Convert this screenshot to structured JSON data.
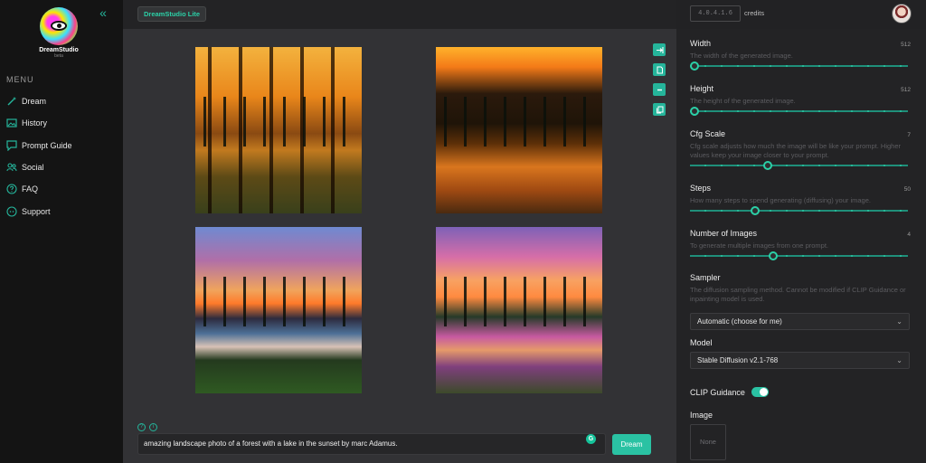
{
  "sidebar": {
    "logo_title": "DreamStudio",
    "logo_subtitle": "beta",
    "menu_title": "MENU",
    "items": [
      {
        "label": "Dream",
        "icon": "wand-icon"
      },
      {
        "label": "History",
        "icon": "image-gallery-icon"
      },
      {
        "label": "Prompt Guide",
        "icon": "quote-bubble-icon"
      },
      {
        "label": "Social",
        "icon": "people-icon"
      },
      {
        "label": "FAQ",
        "icon": "question-circle-icon"
      },
      {
        "label": "Support",
        "icon": "discord-icon"
      }
    ]
  },
  "topbar": {
    "brand": "DreamStudio Lite",
    "credits_value": "4.0.4.1.6",
    "credits_label": "credits"
  },
  "colors": {
    "accent": "#2ac2a3",
    "panel_bg": "#232325",
    "main_bg": "#323235",
    "sidebar_bg": "#141414"
  },
  "main": {
    "images": [
      {
        "alt": "forest lake sunset 1"
      },
      {
        "alt": "forest lake sunset 2"
      },
      {
        "alt": "forest lake sunset 3"
      },
      {
        "alt": "forest lake sunset 4"
      }
    ],
    "tools": [
      "expand-icon",
      "file-icon",
      "minus-icon",
      "copy-icon"
    ],
    "prompt": "amazing landscape photo of a forest with a lake in the sunset by marc Adamus.",
    "grammarly": "G",
    "dream_button": "Dream",
    "help_glyph": "?",
    "info_glyph": "i"
  },
  "settings": {
    "width": {
      "label": "Width",
      "value": "512",
      "description": "The width of the generated image.",
      "fraction": 0.0
    },
    "height": {
      "label": "Height",
      "value": "512",
      "description": "The height of the generated image.",
      "fraction": 0.0
    },
    "cfg": {
      "label": "Cfg Scale",
      "value": "7",
      "description": "Cfg scale adjusts how much the image will be like your prompt. Higher values keep your image closer to your prompt.",
      "fraction": 0.35
    },
    "steps": {
      "label": "Steps",
      "value": "50",
      "description": "How many steps to spend generating (diffusing) your image.",
      "fraction": 0.29
    },
    "images": {
      "label": "Number of Images",
      "value": "4",
      "description": "To generate multiple images from one prompt.",
      "fraction": 0.375
    },
    "sampler": {
      "label": "Sampler",
      "description": "The diffusion sampling method. Cannot be modified if CLIP Guidance or inpainting model is used.",
      "selected": "Automatic (choose for me)"
    },
    "model": {
      "label": "Model",
      "selected": "Stable Diffusion v2.1-768"
    },
    "clip": {
      "label": "CLIP Guidance",
      "enabled": true
    },
    "image": {
      "label": "Image",
      "placeholder": "None"
    }
  }
}
